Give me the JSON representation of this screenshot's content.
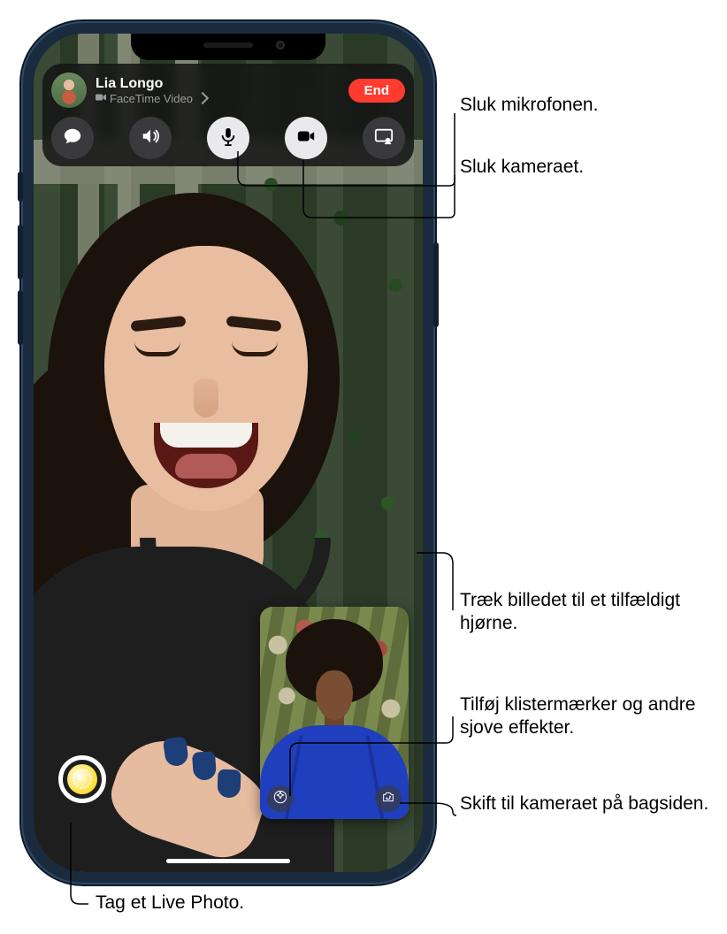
{
  "caller": {
    "name": "Lia Longo",
    "subtitle": "FaceTime Video"
  },
  "end_button": "End",
  "control_icons": {
    "messages": "messages",
    "speaker": "speaker",
    "mic": "microphone",
    "camera": "video-camera",
    "shareplay": "shareplay"
  },
  "pip_icons": {
    "effects": "effects-star",
    "flip": "camera-flip"
  },
  "callouts": {
    "mic_off": "Sluk mikrofonen.",
    "camera_off": "Sluk kameraet.",
    "drag_pip": "Træk billedet til et tilfældigt hjørne.",
    "effects": "Tilføj klistermærker og andre sjove effekter.",
    "flip_camera": "Skift til kameraet på bagsiden.",
    "live_photo": "Tag et Live Photo."
  }
}
